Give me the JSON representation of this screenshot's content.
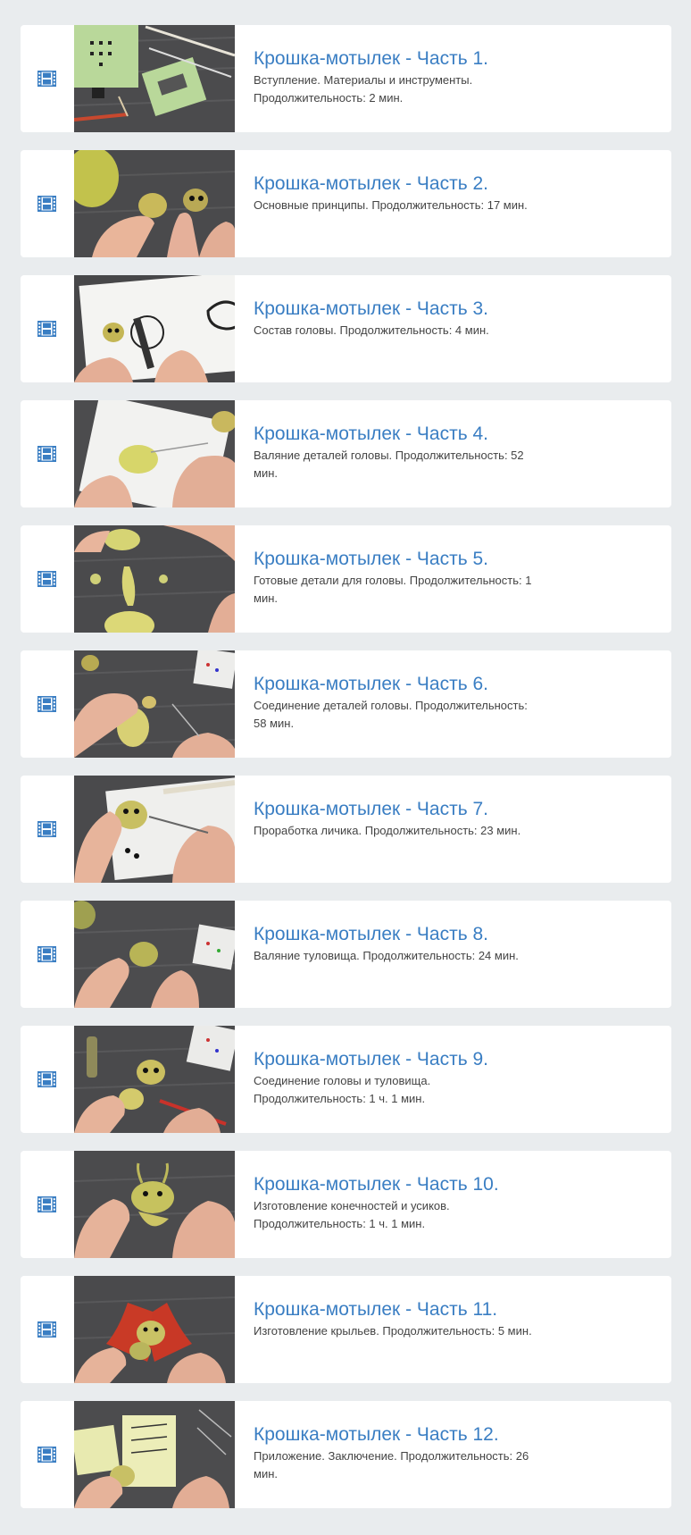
{
  "colors": {
    "page_background": "#e9ecee",
    "card_background": "#ffffff",
    "title_link": "#3a7ec3",
    "description_text": "#444444",
    "video_icon": "#3a7ec3"
  },
  "lessons": [
    {
      "icon": "video-film-icon",
      "thumbnail": "tools-and-materials-on-wooden-table",
      "title": "Крошка-мотылек - Часть 1.",
      "description": "Вступление. Материалы и инструменты. Продолжительность: 2 мин."
    },
    {
      "icon": "video-film-icon",
      "thumbnail": "hands-holding-felted-wool-head",
      "title": "Крошка-мотылек - Часть 2.",
      "description": "Основные принципы. Продолжительность: 17 мин."
    },
    {
      "icon": "video-film-icon",
      "thumbnail": "hand-drawing-face-sketch",
      "title": "Крошка-мотылек - Часть 3.",
      "description": "Состав головы. Продолжительность: 4 мин."
    },
    {
      "icon": "video-film-icon",
      "thumbnail": "felting-on-white-napkin",
      "title": "Крошка-мотылек - Часть 4.",
      "description": "Валяние деталей головы. Продолжительность: 52 мин."
    },
    {
      "icon": "video-film-icon",
      "thumbnail": "finished-head-parts",
      "title": "Крошка-мотылек - Часть 5.",
      "description": "Готовые детали для головы. Продолжительность: 1 мин."
    },
    {
      "icon": "video-film-icon",
      "thumbnail": "joining-head-parts",
      "title": "Крошка-мотылек - Часть 6.",
      "description": "Соединение деталей головы. Продолжительность: 58 мин."
    },
    {
      "icon": "video-film-icon",
      "thumbnail": "detailing-the-face",
      "title": "Крошка-мотылек - Часть 7.",
      "description": "Проработка личика. Продолжительность: 23 мин."
    },
    {
      "icon": "video-film-icon",
      "thumbnail": "felting-the-body",
      "title": "Крошка-мотылек - Часть 8.",
      "description": "Валяние туловища. Продолжительность: 24 мин."
    },
    {
      "icon": "video-film-icon",
      "thumbnail": "joining-head-and-body",
      "title": "Крошка-мотылек - Часть 9.",
      "description": "Соединение головы и туловища. Продолжительность: 1 ч. 1 мин."
    },
    {
      "icon": "video-film-icon",
      "thumbnail": "making-limbs-and-antennae",
      "title": "Крошка-мотылек - Часть 10.",
      "description": "Изготовление конечностей и усиков. Продолжительность: 1 ч. 1 мин."
    },
    {
      "icon": "video-film-icon",
      "thumbnail": "making-red-wings",
      "title": "Крошка-мотылек - Часть 11.",
      "description": "Изготовление крыльев. Продолжительность: 5 мин."
    },
    {
      "icon": "video-film-icon",
      "thumbnail": "conclusion-with-templates",
      "title": "Крошка-мотылек - Часть 12.",
      "description": "Приложение. Заключение. Продолжительность: 26 мин."
    }
  ]
}
